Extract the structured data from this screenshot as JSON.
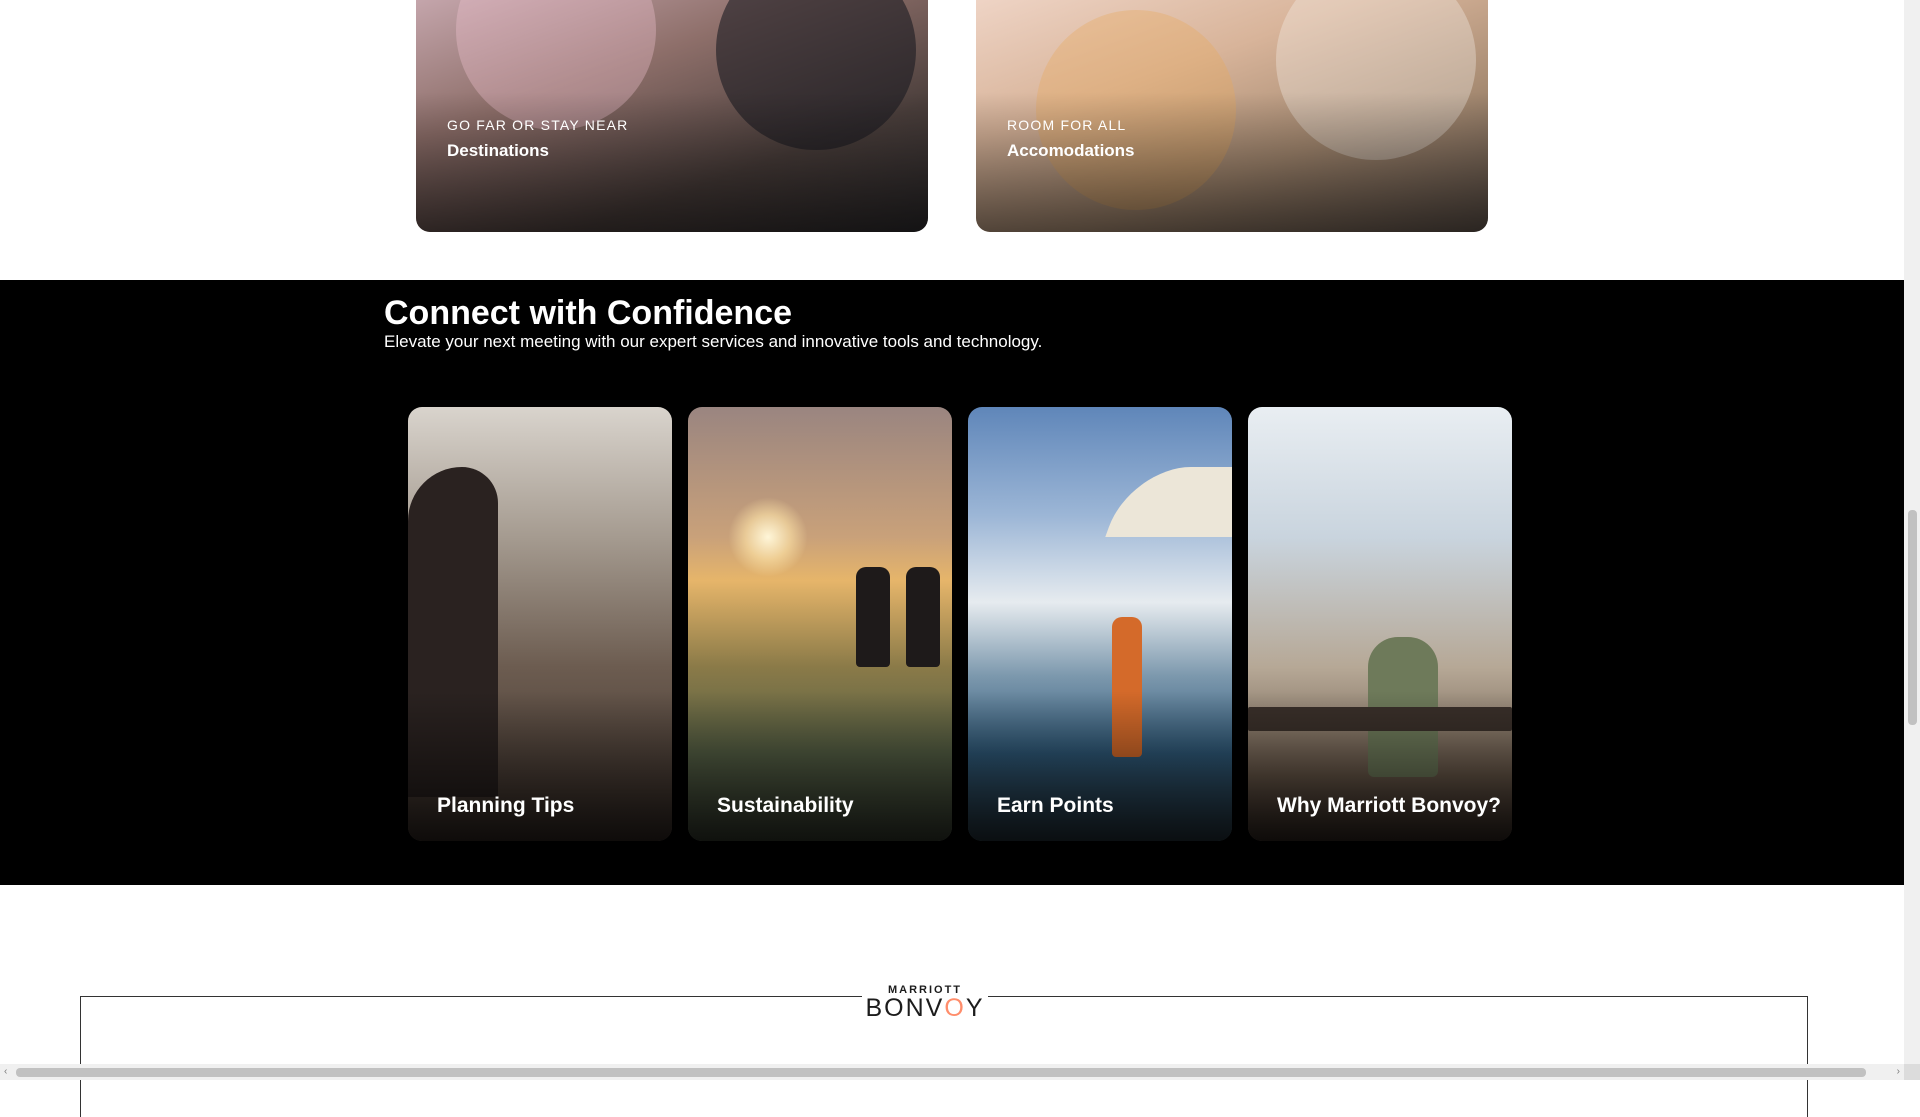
{
  "feature_cards": [
    {
      "eyebrow": "GO FAR OR STAY NEAR",
      "title": "Destinations"
    },
    {
      "eyebrow": "ROOM FOR ALL",
      "title": "Accomodations"
    }
  ],
  "connect": {
    "heading": "Connect with Confidence",
    "subheading": "Elevate your next meeting with our expert services and innovative tools and technology.",
    "tiles": [
      {
        "label": "Planning Tips"
      },
      {
        "label": "Sustainability"
      },
      {
        "label": "Earn Points"
      },
      {
        "label": "Why Marriott Bonvoy?"
      }
    ]
  },
  "footer": {
    "logo_top": "MARRIOTT",
    "logo_bottom_a": "BONV",
    "logo_bottom_dot": "O",
    "logo_bottom_b": "Y"
  },
  "scrollbars": {
    "left_arrow": "‹",
    "right_arrow": "›"
  }
}
